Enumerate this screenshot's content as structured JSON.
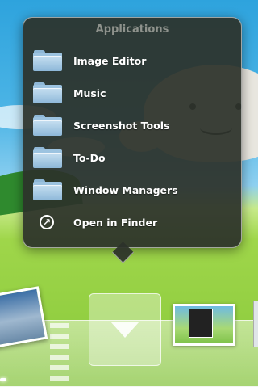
{
  "stack": {
    "title": "Applications",
    "items": [
      {
        "label": "Image Editor",
        "icon": "folder-icon"
      },
      {
        "label": "Music",
        "icon": "folder-icon"
      },
      {
        "label": "Screenshot Tools",
        "icon": "folder-icon"
      },
      {
        "label": "To-Do",
        "icon": "folder-icon"
      },
      {
        "label": "Window Managers",
        "icon": "folder-icon"
      }
    ],
    "open_in_finder": {
      "label": "Open in Finder",
      "icon": "arrow-circle-icon"
    }
  },
  "colors": {
    "popup_background": "#2c322a",
    "folder_blue": "#9cc3e0",
    "wallpaper_green": "#88c93b",
    "wallpaper_sky": "#4db5e6"
  }
}
